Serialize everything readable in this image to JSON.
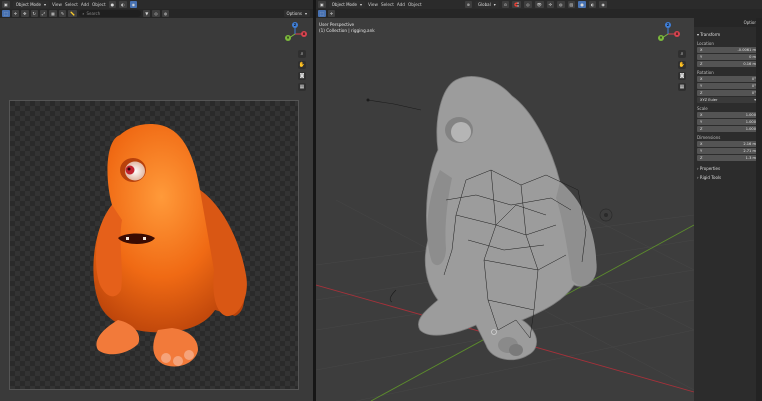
{
  "left_editor": {
    "mode_dropdown": "Object Mode",
    "menu": [
      "View",
      "Select",
      "Add",
      "Object"
    ],
    "search_placeholder": "Search",
    "options_label": "Options"
  },
  "right_editor": {
    "mode_dropdown": "Object Mode",
    "menu": [
      "View",
      "Select",
      "Add",
      "Object"
    ],
    "transform_orientation": "Global",
    "viewport_view_label": "User Perspective",
    "viewport_collection_label": "(1) Collection | rigging.ank"
  },
  "n_panel": {
    "options_label": "Options",
    "transform_header": "Transform",
    "location_label": "Location",
    "location": {
      "x": "-0.0061 m",
      "y": "0 m",
      "z": "0.16 m"
    },
    "rotation_label": "Rotation",
    "rotation": {
      "x": "0°",
      "y": "0°",
      "z": "0°"
    },
    "rotation_mode": "XYZ Euler",
    "scale_label": "Scale",
    "scale": {
      "x": "1.000",
      "y": "1.000",
      "z": "1.000"
    },
    "dimensions_label": "Dimensions",
    "dimensions": {
      "x": "2.16 m",
      "y": "2.71 m",
      "z": "1.3 m"
    },
    "properties_header": "Properties",
    "rigid_tools_header": "Rigid Tools"
  },
  "colors": {
    "monster_orange": "#f06a14",
    "clay_gray": "#9c9c9c",
    "x_axis": "#d9434f",
    "y_axis": "#7cba3c",
    "z_axis": "#3f7fd9"
  }
}
